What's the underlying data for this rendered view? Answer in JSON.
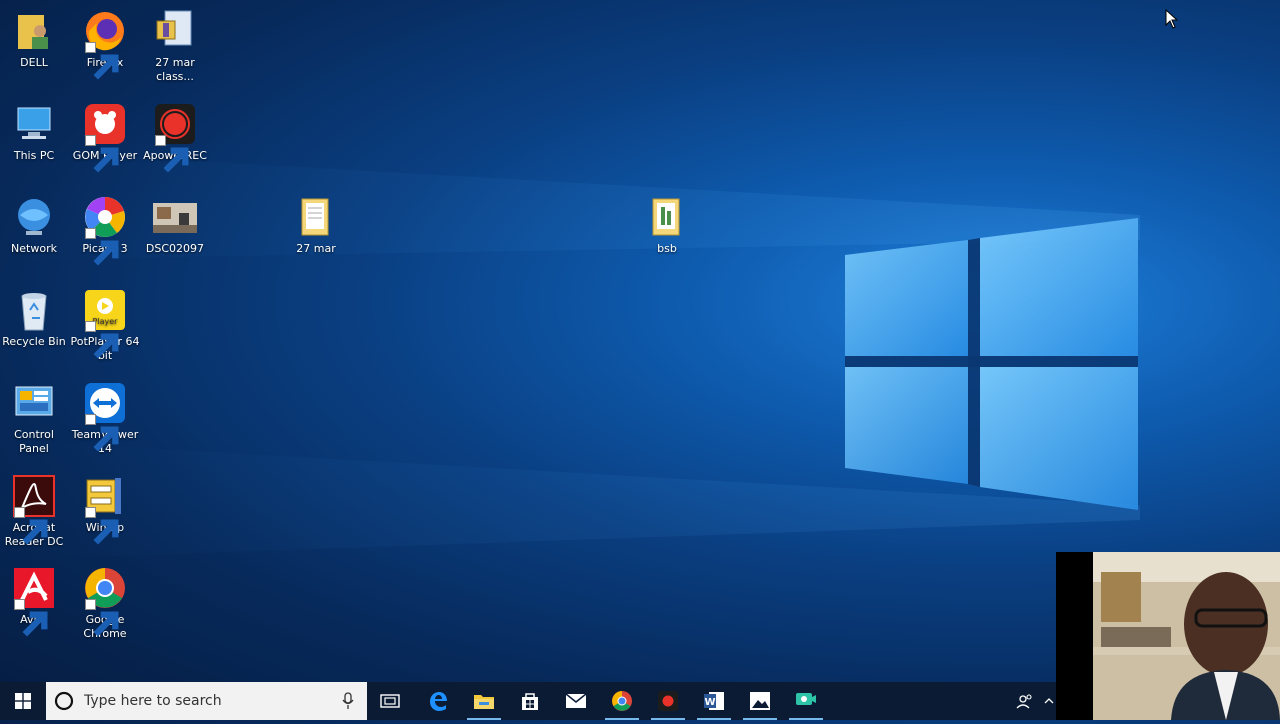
{
  "desktop": {
    "icons": [
      {
        "label": "DELL"
      },
      {
        "label": "Firefox"
      },
      {
        "label": "27 mar class..."
      },
      {
        "label": "This PC"
      },
      {
        "label": "GOM Player"
      },
      {
        "label": "ApowerREC"
      },
      {
        "label": "Network"
      },
      {
        "label": "Picasa 3"
      },
      {
        "label": "DSC02097"
      },
      {
        "label": "27 mar"
      },
      {
        "label": "bsb"
      },
      {
        "label": "Recycle Bin"
      },
      {
        "label": "PotPlayer 64 bit"
      },
      {
        "label": "Control Panel"
      },
      {
        "label": "TeamViewer 14"
      },
      {
        "label": "Acrobat Reader DC"
      },
      {
        "label": "WinZip"
      },
      {
        "label": "Avira"
      },
      {
        "label": "Google Chrome"
      }
    ],
    "potplayer_badge": "Player"
  },
  "taskbar": {
    "search_placeholder": "Type here to search",
    "pinned": [
      "task-view",
      "edge",
      "file-explorer",
      "store",
      "mail",
      "chrome",
      "apowerrec",
      "word",
      "photos",
      "screen-recorder"
    ],
    "word_letter": "W"
  },
  "colors": {
    "taskbar": "#0b1b33",
    "accent": "#76b9ed",
    "desktop_glow": "#1f7fd8"
  }
}
